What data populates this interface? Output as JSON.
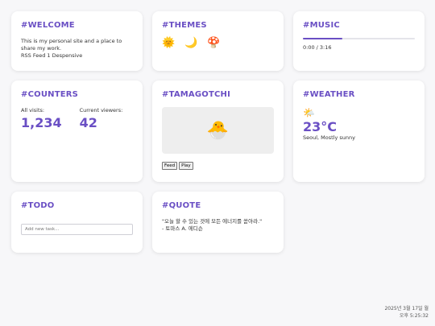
{
  "welcome": {
    "title": "#WELCOME",
    "text": "This is my personal site and a place to share my work.",
    "links": "RSS Feed 1 Despensive"
  },
  "themes": {
    "title": "#THEMES",
    "items": [
      {
        "icon": "sun-icon",
        "glyph": "🌞"
      },
      {
        "icon": "moon-icon",
        "glyph": "🌙"
      },
      {
        "icon": "mushroom-icon",
        "glyph": "🍄"
      }
    ]
  },
  "music": {
    "title": "#MUSIC",
    "progress": 0.35,
    "time": "0:00 / 3:16"
  },
  "counters": {
    "title": "#COUNTERS",
    "visits_label": "All visits:",
    "visits_value": "1,234",
    "viewers_label": "Current viewers:",
    "viewers_value": "42"
  },
  "tamagotchi": {
    "title": "#TAMAGOTCHI",
    "pet_glyph": "🐣",
    "pet_icon": "hatching-chick-icon",
    "feed_label": "Feed",
    "play_label": "Play"
  },
  "weather": {
    "title": "#WEATHER",
    "icon": "sun-behind-cloud-icon",
    "glyph": "🌤️",
    "temp": "23°C",
    "desc": "Seoul, Mostly sunny"
  },
  "todo": {
    "title": "#TODO",
    "placeholder": "Add new task..."
  },
  "quote": {
    "title": "#QUOTE",
    "text": "\"오늘 할 수 있는 것에 모든 에너지를 쏟아라.\"",
    "author": "- 토마스 A. 에디슨"
  },
  "clock": {
    "date": "2025년 3월 17일 월",
    "time": "오후 5:25:32"
  },
  "colors": {
    "accent": "#6a4fc4",
    "background": "#f7f7f9",
    "card": "#ffffff"
  }
}
